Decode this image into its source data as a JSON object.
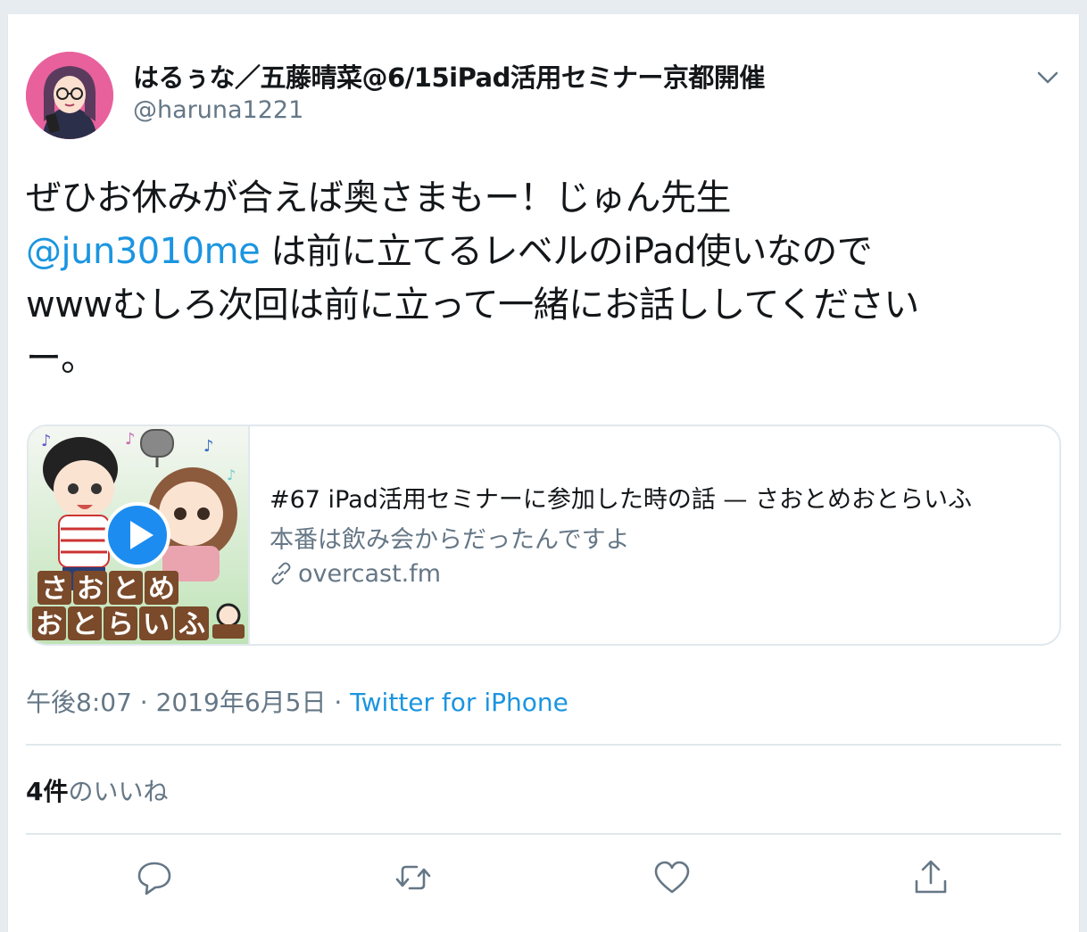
{
  "tweet": {
    "display_name": "はるぅな／五藤晴菜@6/15iPad活用セミナー京都開催",
    "handle": "@haruna1221",
    "text_line1": "ぜひお休みが合えば奥さまもー！じゅん先生",
    "mention": "@jun3010me",
    "text_line2_rest": " は前に立てるレベルのiPad使いなので",
    "text_line3": "wwwむしろ次回は前に立って一緒にお話ししてください",
    "text_line4": "ー。",
    "time": "午後8:07",
    "date": "2019年6月5日",
    "source": "Twitter for iPhone",
    "sep": " · ",
    "likes_count": "4件",
    "likes_label": "のいいね"
  },
  "link_card": {
    "title": "#67 iPad活用セミナーに参加した時の話 — さおとめおとらいふ",
    "description": "本番は飲み会からだったんですよ",
    "domain": "overcast.fm",
    "thumb_row1": [
      "さ",
      "お",
      "と",
      "め"
    ],
    "thumb_row2": [
      "お",
      "と",
      "ら",
      "い",
      "ふ"
    ]
  },
  "actions": [
    "reply-icon",
    "retweet-icon",
    "like-icon",
    "share-icon"
  ],
  "colors": {
    "link": "#1b95e0",
    "secondary_text": "#657786",
    "border": "#e1e8ed",
    "play_button": "#1d8cf0"
  }
}
